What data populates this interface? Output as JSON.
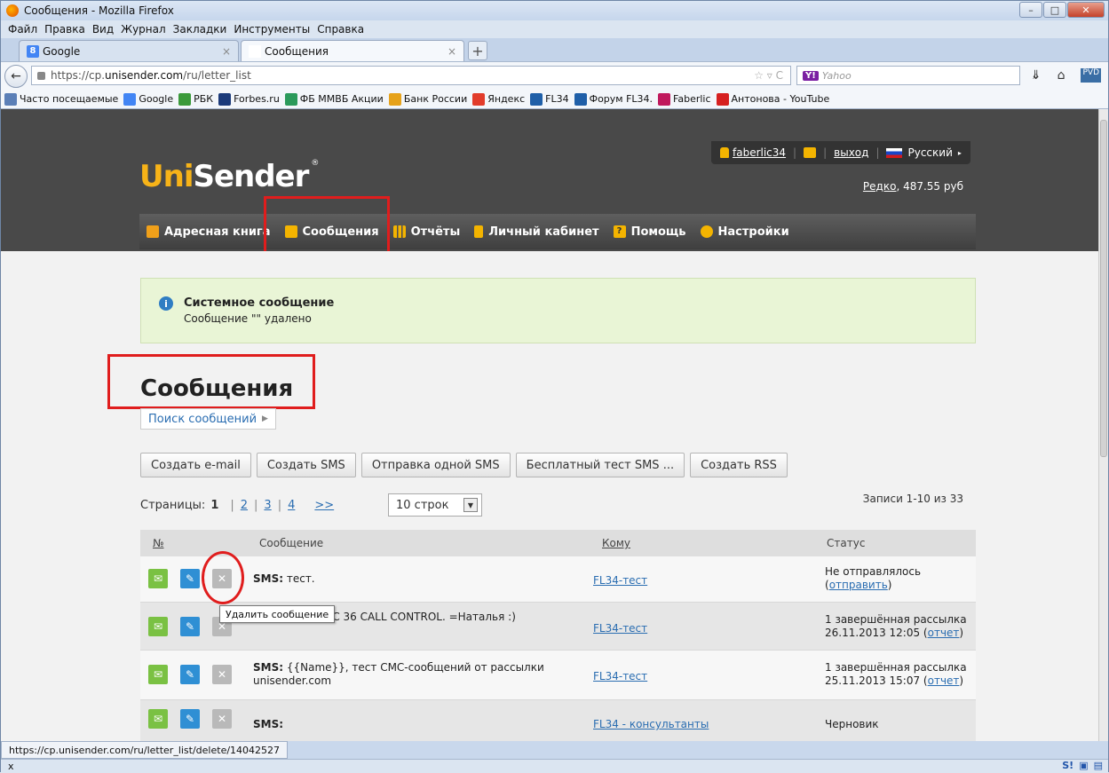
{
  "window": {
    "title": "Сообщения - Mozilla Firefox"
  },
  "menu": [
    "Файл",
    "Правка",
    "Вид",
    "Журнал",
    "Закладки",
    "Инструменты",
    "Справка"
  ],
  "tabs": [
    {
      "label": "Google"
    },
    {
      "label": "Сообщения"
    }
  ],
  "address": {
    "prefix": "https://cp.",
    "domain": "unisender.com",
    "path": "/ru/letter_list"
  },
  "search": {
    "engine": "Yahoo",
    "placeholder": "Yahoo"
  },
  "bookmarks": [
    {
      "label": "Часто посещаемые",
      "color": "#5b7fb7"
    },
    {
      "label": "Google",
      "color": "#4285f4"
    },
    {
      "label": "РБК",
      "color": "#3b9a3b"
    },
    {
      "label": "Forbes.ru",
      "color": "#1b3a7a"
    },
    {
      "label": "ФБ ММВБ Акции",
      "color": "#2b9a5b"
    },
    {
      "label": "Банк России",
      "color": "#e6a21b"
    },
    {
      "label": "Яндекс",
      "color": "#e23c2b"
    },
    {
      "label": "FL34",
      "color": "#1f5fa8"
    },
    {
      "label": "Форум FL34.",
      "color": "#1f5fa8"
    },
    {
      "label": "Faberlic",
      "color": "#c0195d"
    },
    {
      "label": "Антонова - YouTube",
      "color": "#d62020"
    }
  ],
  "site": {
    "logo_a": "Uni",
    "logo_b": "Sender",
    "logo_mark": "®",
    "user": "faberlic34",
    "logout": "выход",
    "language": "Русский",
    "balance_link": "Редко",
    "balance_value": ", 487.55 руб",
    "nav": [
      {
        "label": "Адресная книга",
        "color": "#f0a01a"
      },
      {
        "label": "Сообщения",
        "color": "#f4b400"
      },
      {
        "label": "Отчёты",
        "color": "#f4b400"
      },
      {
        "label": "Личный кабинет",
        "color": "#f4b400"
      },
      {
        "label": "Помощь",
        "color": "#f4b400"
      },
      {
        "label": "Настройки",
        "color": "#f4b400"
      }
    ]
  },
  "system_message": {
    "title": "Системное сообщение",
    "text": "Сообщение \"\" удалено"
  },
  "page_title": "Сообщения",
  "search_messages": "Поиск сообщений",
  "buttons": [
    "Создать e-mail",
    "Создать SMS",
    "Отправка одной SMS",
    "Бесплатный тест SMS ...",
    "Создать RSS"
  ],
  "pager": {
    "label": "Страницы:",
    "current": "1",
    "pages": [
      "2",
      "3",
      "4"
    ],
    "next": ">>",
    "rows": "10 строк"
  },
  "records": "Записи 1-10 из 33",
  "table": {
    "headers": {
      "num": "№",
      "message": "Сообщение",
      "to": "Кому",
      "status": "Статус"
    },
    "rows": [
      {
        "prefix": "SMS:",
        "text": " тест.",
        "to": "FL34-тест",
        "status": "Не отправлялось",
        "status_link": "отправить",
        "status_link_wrap": [
          "(",
          ")"
        ]
      },
      {
        "prefix": "",
        "text": "a Sennheiser PC 36 CALL CONTROL. =Наталья :)",
        "to": "FL34-тест",
        "status": "1 завершённая рассылка",
        "status2": "26.11.2013 12:05",
        "status_link": "отчет"
      },
      {
        "prefix": "SMS:",
        "text": " {{Name}}, тест СМС-сообщений от рассылки unisender.com",
        "to": "FL34-тест",
        "status": "1 завершённая рассылка",
        "status2": "25.11.2013 15:07",
        "status_link": "отчет"
      },
      {
        "prefix": "SMS:",
        "text": "",
        "to": "FL34 - консультанты",
        "status": "Черновик"
      }
    ]
  },
  "tooltip": "Удалить сообщение",
  "status_url": "https://cp.unisender.com/ru/letter_list/delete/14042527",
  "bottom_close": "x"
}
